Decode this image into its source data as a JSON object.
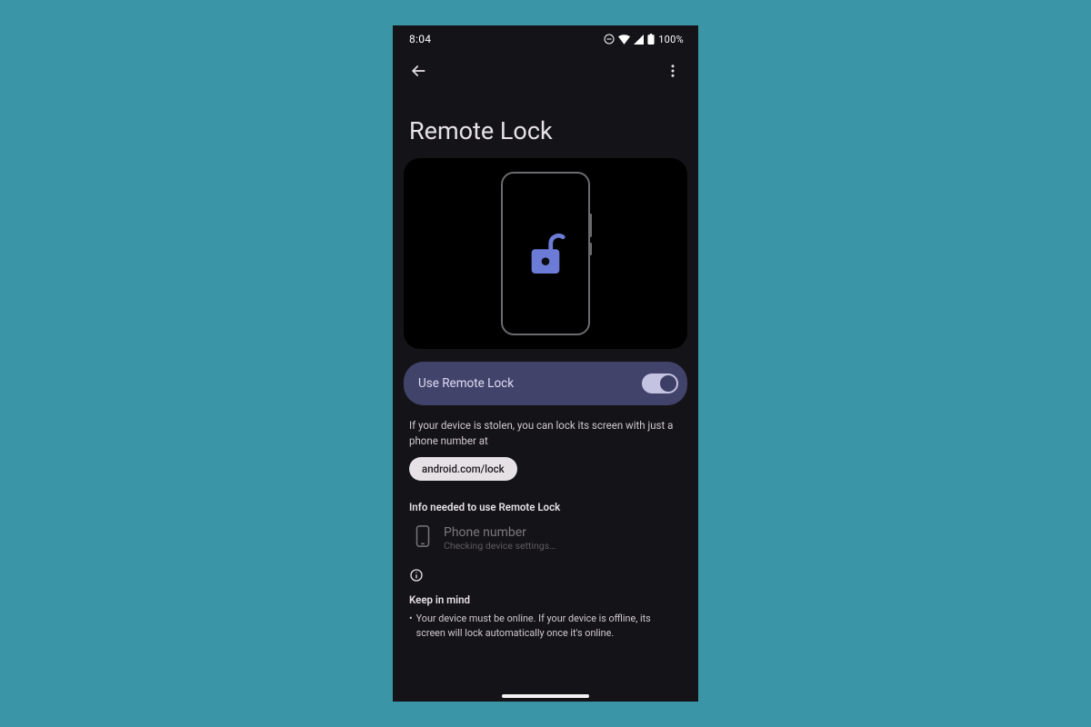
{
  "status_bar": {
    "time": "8:04",
    "battery_text": "100%"
  },
  "appbar": {
    "back_icon": "back-arrow",
    "menu_icon": "more-vert"
  },
  "page": {
    "title": "Remote Lock"
  },
  "hero": {
    "icon": "unlock-icon"
  },
  "toggle": {
    "label": "Use Remote Lock",
    "state": "on"
  },
  "description": "If your device is stolen, you can lock its screen with just a phone number at",
  "link_chip": "android.com/lock",
  "sections": {
    "info_header": "Info needed to use Remote Lock",
    "phone_item": {
      "title": "Phone number",
      "subtitle": "Checking device settings…"
    },
    "keep_in_mind_header": "Keep in mind",
    "keep_bullet_1": "Your device must be online. If your device is offline, its screen will lock automatically once it's online."
  }
}
